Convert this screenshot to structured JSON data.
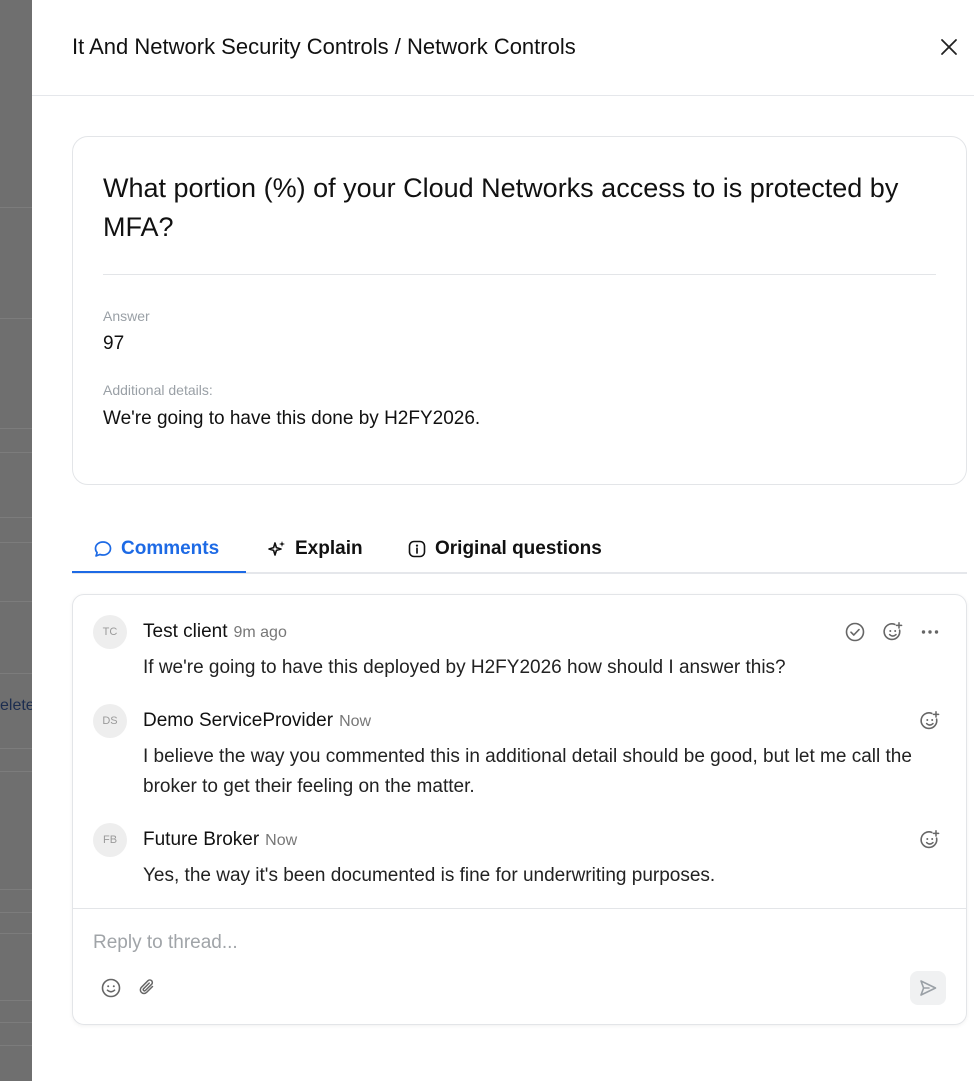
{
  "background": {
    "peek_text": "elete"
  },
  "header": {
    "title": "It And Network Security Controls / Network Controls"
  },
  "question": {
    "text": "What portion (%) of your Cloud Networks access to is protected by MFA?",
    "answer_label": "Answer",
    "answer_value": "97",
    "details_label": "Additional details:",
    "details_value": "We're going to have this done by H2FY2026."
  },
  "tabs": [
    {
      "label": "Comments",
      "icon": "chat-bubble-icon",
      "active": true
    },
    {
      "label": "Explain",
      "icon": "sparkles-icon",
      "active": false
    },
    {
      "label": "Original questions",
      "icon": "info-icon",
      "active": false
    }
  ],
  "comments": [
    {
      "initials": "TC",
      "author": "Test client",
      "time": "9m ago",
      "text": "If we're going to have this deployed by H2FY2026 how should I answer this?"
    },
    {
      "initials": "DS",
      "author": "Demo ServiceProvider",
      "time": "Now",
      "text": "I believe the way you commented this in additional detail should be good, but let me call the broker to get their feeling on the matter."
    },
    {
      "initials": "FB",
      "author": "Future Broker",
      "time": "Now",
      "text": "Yes, the way it's been documented is fine for underwriting purposes."
    }
  ],
  "reply": {
    "placeholder": "Reply to thread..."
  },
  "colors": {
    "accent": "#1d6ae5",
    "border": "#e3e5e8",
    "muted": "#9aa0a6"
  }
}
